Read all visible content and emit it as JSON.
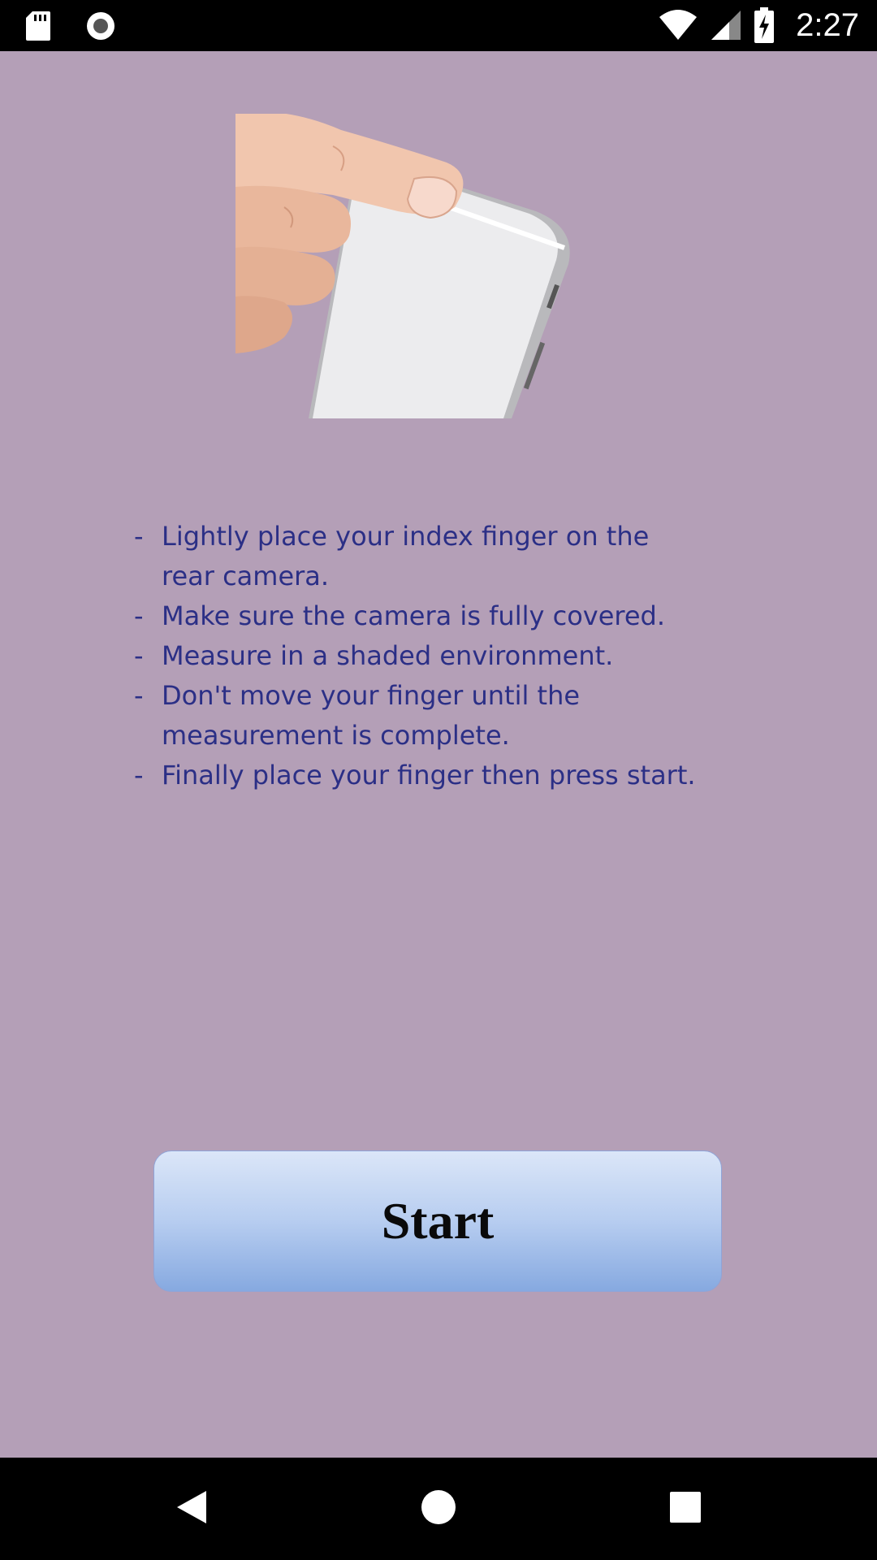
{
  "status_bar": {
    "time": "2:27",
    "icons": [
      "sd-card-icon",
      "record-icon",
      "wifi-icon",
      "signal-icon",
      "battery-charging-icon"
    ]
  },
  "illustration": {
    "icon": "finger-on-phone-camera-illustration"
  },
  "instructions": [
    "Lightly place your index finger on the rear camera.",
    "Make sure the camera is fully covered.",
    "Measure in a shaded environment.",
    "Don't move your finger until the measurement is complete.",
    "Finally place your finger then press start."
  ],
  "start_button": {
    "label": "Start"
  },
  "nav_bar": {
    "icons": [
      "back-icon",
      "home-icon",
      "recents-icon"
    ]
  },
  "colors": {
    "background": "#b49fb7",
    "instruction_text": "#2b2f86",
    "button_top": "#dbe6f8",
    "button_bottom": "#86a9e0"
  }
}
